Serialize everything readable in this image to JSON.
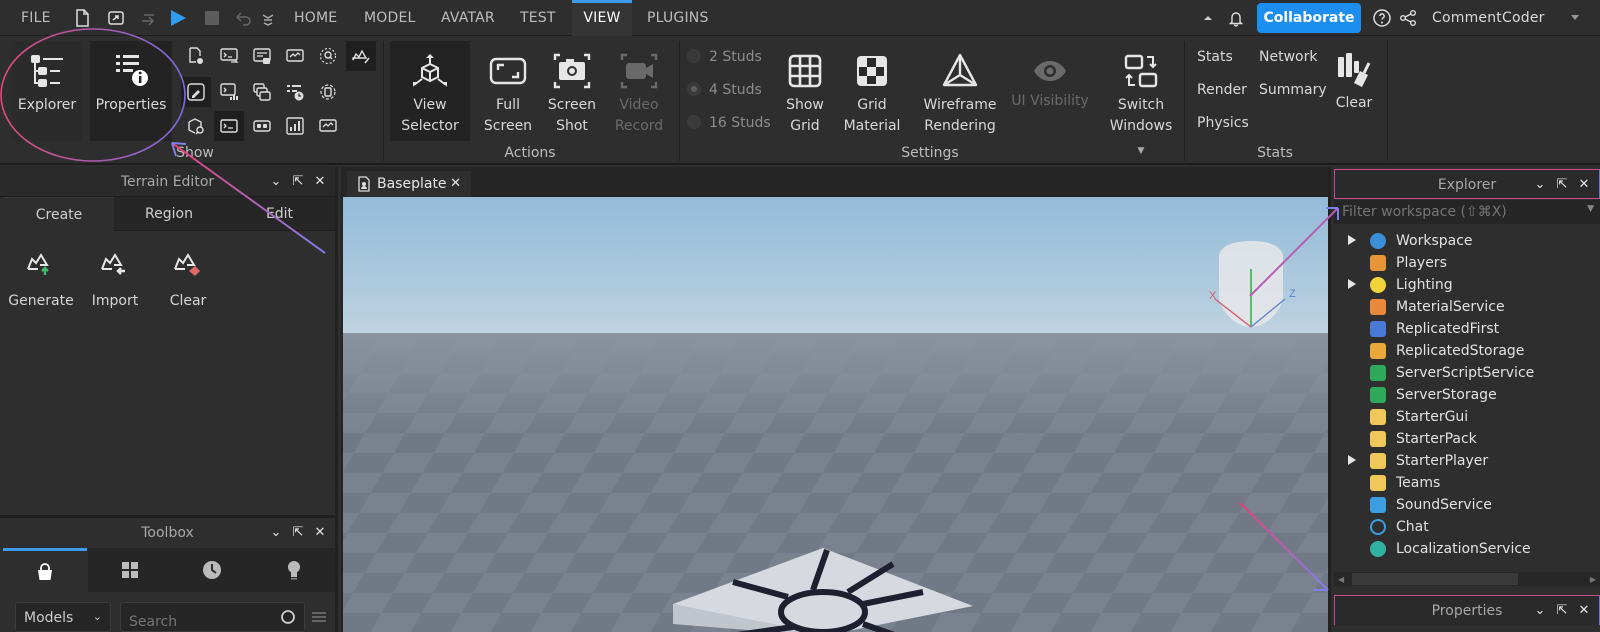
{
  "topbar": {
    "file_label": "FILE",
    "icons": [
      "new-file-icon",
      "open-place-icon",
      "redo-icon",
      "play-icon",
      "stop-icon",
      "undo-icon",
      "quick-access-icon"
    ],
    "tabs": [
      {
        "label": "HOME",
        "active": false
      },
      {
        "label": "MODEL",
        "active": false
      },
      {
        "label": "AVATAR",
        "active": false
      },
      {
        "label": "TEST",
        "active": false
      },
      {
        "label": "VIEW",
        "active": true
      },
      {
        "label": "PLUGINS",
        "active": false
      }
    ],
    "collaborate_label": "Collaborate",
    "username": "CommentCoder",
    "accent_color": "#1c8ef0"
  },
  "ribbon": {
    "show_group": {
      "label": "Show",
      "explorer_label": "Explorer",
      "properties_label": "Properties"
    },
    "actions_group": {
      "label": "Actions",
      "view_selector": "View Selector",
      "full_screen": "Full Screen",
      "screen_shot": "Screen Shot",
      "video_record": "Video Record"
    },
    "settings_group": {
      "label": "Settings",
      "studs": [
        {
          "label": "2 Studs",
          "selected": false
        },
        {
          "label": "4 Studs",
          "selected": true
        },
        {
          "label": "16 Studs",
          "selected": false
        }
      ],
      "show_grid": "Show Grid",
      "grid_material": "Grid Material",
      "wireframe": "Wireframe Rendering",
      "ui_visibility": "UI Visibility",
      "switch_windows": "Switch Windows"
    },
    "stats_group": {
      "label": "Stats",
      "links": [
        "Stats",
        "Network",
        "Render",
        "Summary",
        "Physics"
      ],
      "clear": "Clear"
    }
  },
  "terrain_editor": {
    "title": "Terrain Editor",
    "tabs": [
      "Create",
      "Region",
      "Edit"
    ],
    "active_tab": "Create",
    "tools": [
      "Generate",
      "Import",
      "Clear"
    ]
  },
  "toolbox": {
    "title": "Toolbox",
    "tabs": [
      "marketplace-icon",
      "inventory-icon",
      "recent-icon",
      "creations-icon"
    ],
    "category": "Models",
    "search_placeholder": "Search"
  },
  "document": {
    "tab_label": "Baseplate"
  },
  "explorer": {
    "title": "Explorer",
    "filter_placeholder": "Filter workspace (⇧⌘X)",
    "items": [
      {
        "label": "Workspace",
        "expandable": true,
        "icon": "workspace-icon"
      },
      {
        "label": "Players",
        "expandable": false,
        "icon": "players-icon"
      },
      {
        "label": "Lighting",
        "expandable": true,
        "icon": "lighting-icon"
      },
      {
        "label": "MaterialService",
        "expandable": false,
        "icon": "material-service-icon"
      },
      {
        "label": "ReplicatedFirst",
        "expandable": false,
        "icon": "replicated-first-icon"
      },
      {
        "label": "ReplicatedStorage",
        "expandable": false,
        "icon": "replicated-storage-icon"
      },
      {
        "label": "ServerScriptService",
        "expandable": false,
        "icon": "server-script-service-icon"
      },
      {
        "label": "ServerStorage",
        "expandable": false,
        "icon": "server-storage-icon"
      },
      {
        "label": "StarterGui",
        "expandable": false,
        "icon": "starter-gui-icon"
      },
      {
        "label": "StarterPack",
        "expandable": false,
        "icon": "starter-pack-icon"
      },
      {
        "label": "StarterPlayer",
        "expandable": true,
        "icon": "starter-player-icon"
      },
      {
        "label": "Teams",
        "expandable": false,
        "icon": "teams-icon"
      },
      {
        "label": "SoundService",
        "expandable": false,
        "icon": "sound-service-icon"
      },
      {
        "label": "Chat",
        "expandable": false,
        "icon": "chat-icon"
      },
      {
        "label": "LocalizationService",
        "expandable": false,
        "icon": "localization-service-icon"
      }
    ]
  },
  "properties": {
    "title": "Properties"
  },
  "view_cube": {
    "x_label": "X",
    "z_label": "Z"
  }
}
